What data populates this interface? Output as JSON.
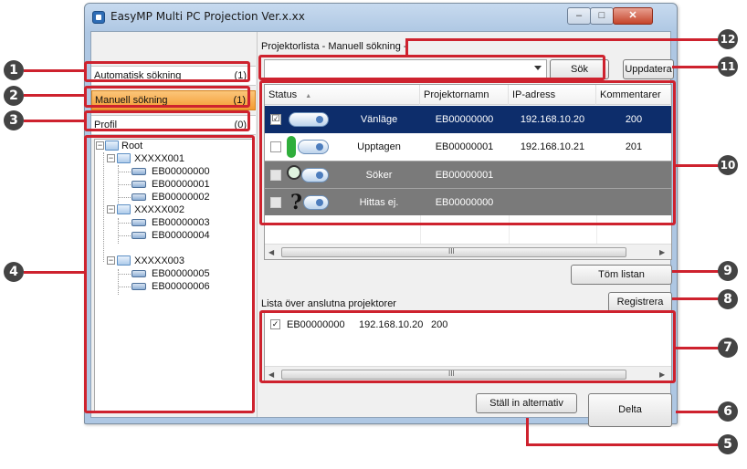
{
  "window": {
    "title": "EasyMP Multi PC Projection Ver.x.xx",
    "min_glyph": "–",
    "max_glyph": "□",
    "close_glyph": "✕"
  },
  "left": {
    "categories": [
      {
        "label": "Automatisk sökning",
        "count": "(1)"
      },
      {
        "label": "Manuell sökning",
        "count": "(1)"
      },
      {
        "label": "Profil",
        "count": "(0)"
      }
    ],
    "tree": {
      "root": "Root",
      "groups": [
        {
          "label": "XXXXX001",
          "items": [
            "EB00000000",
            "EB00000001",
            "EB00000002"
          ]
        },
        {
          "label": "XXXXX002",
          "items": [
            "EB00000003",
            "EB00000004"
          ]
        },
        {
          "label": "XXXXX003",
          "items": [
            "EB00000005",
            "EB00000006"
          ]
        }
      ]
    }
  },
  "search": {
    "list_title": "Projektorlista - Manuell sökning -",
    "value": "",
    "search_button": "Sök",
    "update_button": "Uppdatera"
  },
  "projector_list": {
    "headers": [
      "Status",
      "Projektornamn",
      "IP-adress",
      "Kommentarer"
    ],
    "sort_indicator": "▲",
    "rows": [
      {
        "status": "Vänläge",
        "name": "EB00000000",
        "ip": "192.168.10.20",
        "comment": "200",
        "checked": "☑"
      },
      {
        "status": "Upptagen",
        "name": "EB00000001",
        "ip": "192.168.10.21",
        "comment": "201",
        "checked": ""
      },
      {
        "status": "Söker",
        "name": "EB00000001",
        "ip": "",
        "comment": "",
        "checked": ""
      },
      {
        "status": "Hittas ej.",
        "name": "EB00000000",
        "ip": "",
        "comment": "",
        "checked": ""
      }
    ],
    "scroll_glyph": "III"
  },
  "buttons": {
    "clear": "Töm listan",
    "register": "Registrera",
    "options": "Ställ in alternativ",
    "join": "Delta"
  },
  "connected": {
    "title": "Lista över anslutna projektorer",
    "check_glyph": "✓",
    "entry": {
      "name": "EB00000000",
      "ip": "192.168.10.20",
      "comment": "200"
    }
  },
  "callouts": [
    "1",
    "2",
    "3",
    "4",
    "5",
    "6",
    "7",
    "8",
    "9",
    "10",
    "11",
    "12"
  ],
  "colors": {
    "callout_line": "#ce222e",
    "callout_badge": "#444444",
    "selected_row": "#0d2d6b",
    "manual_search_highlight": "#f49b31"
  }
}
